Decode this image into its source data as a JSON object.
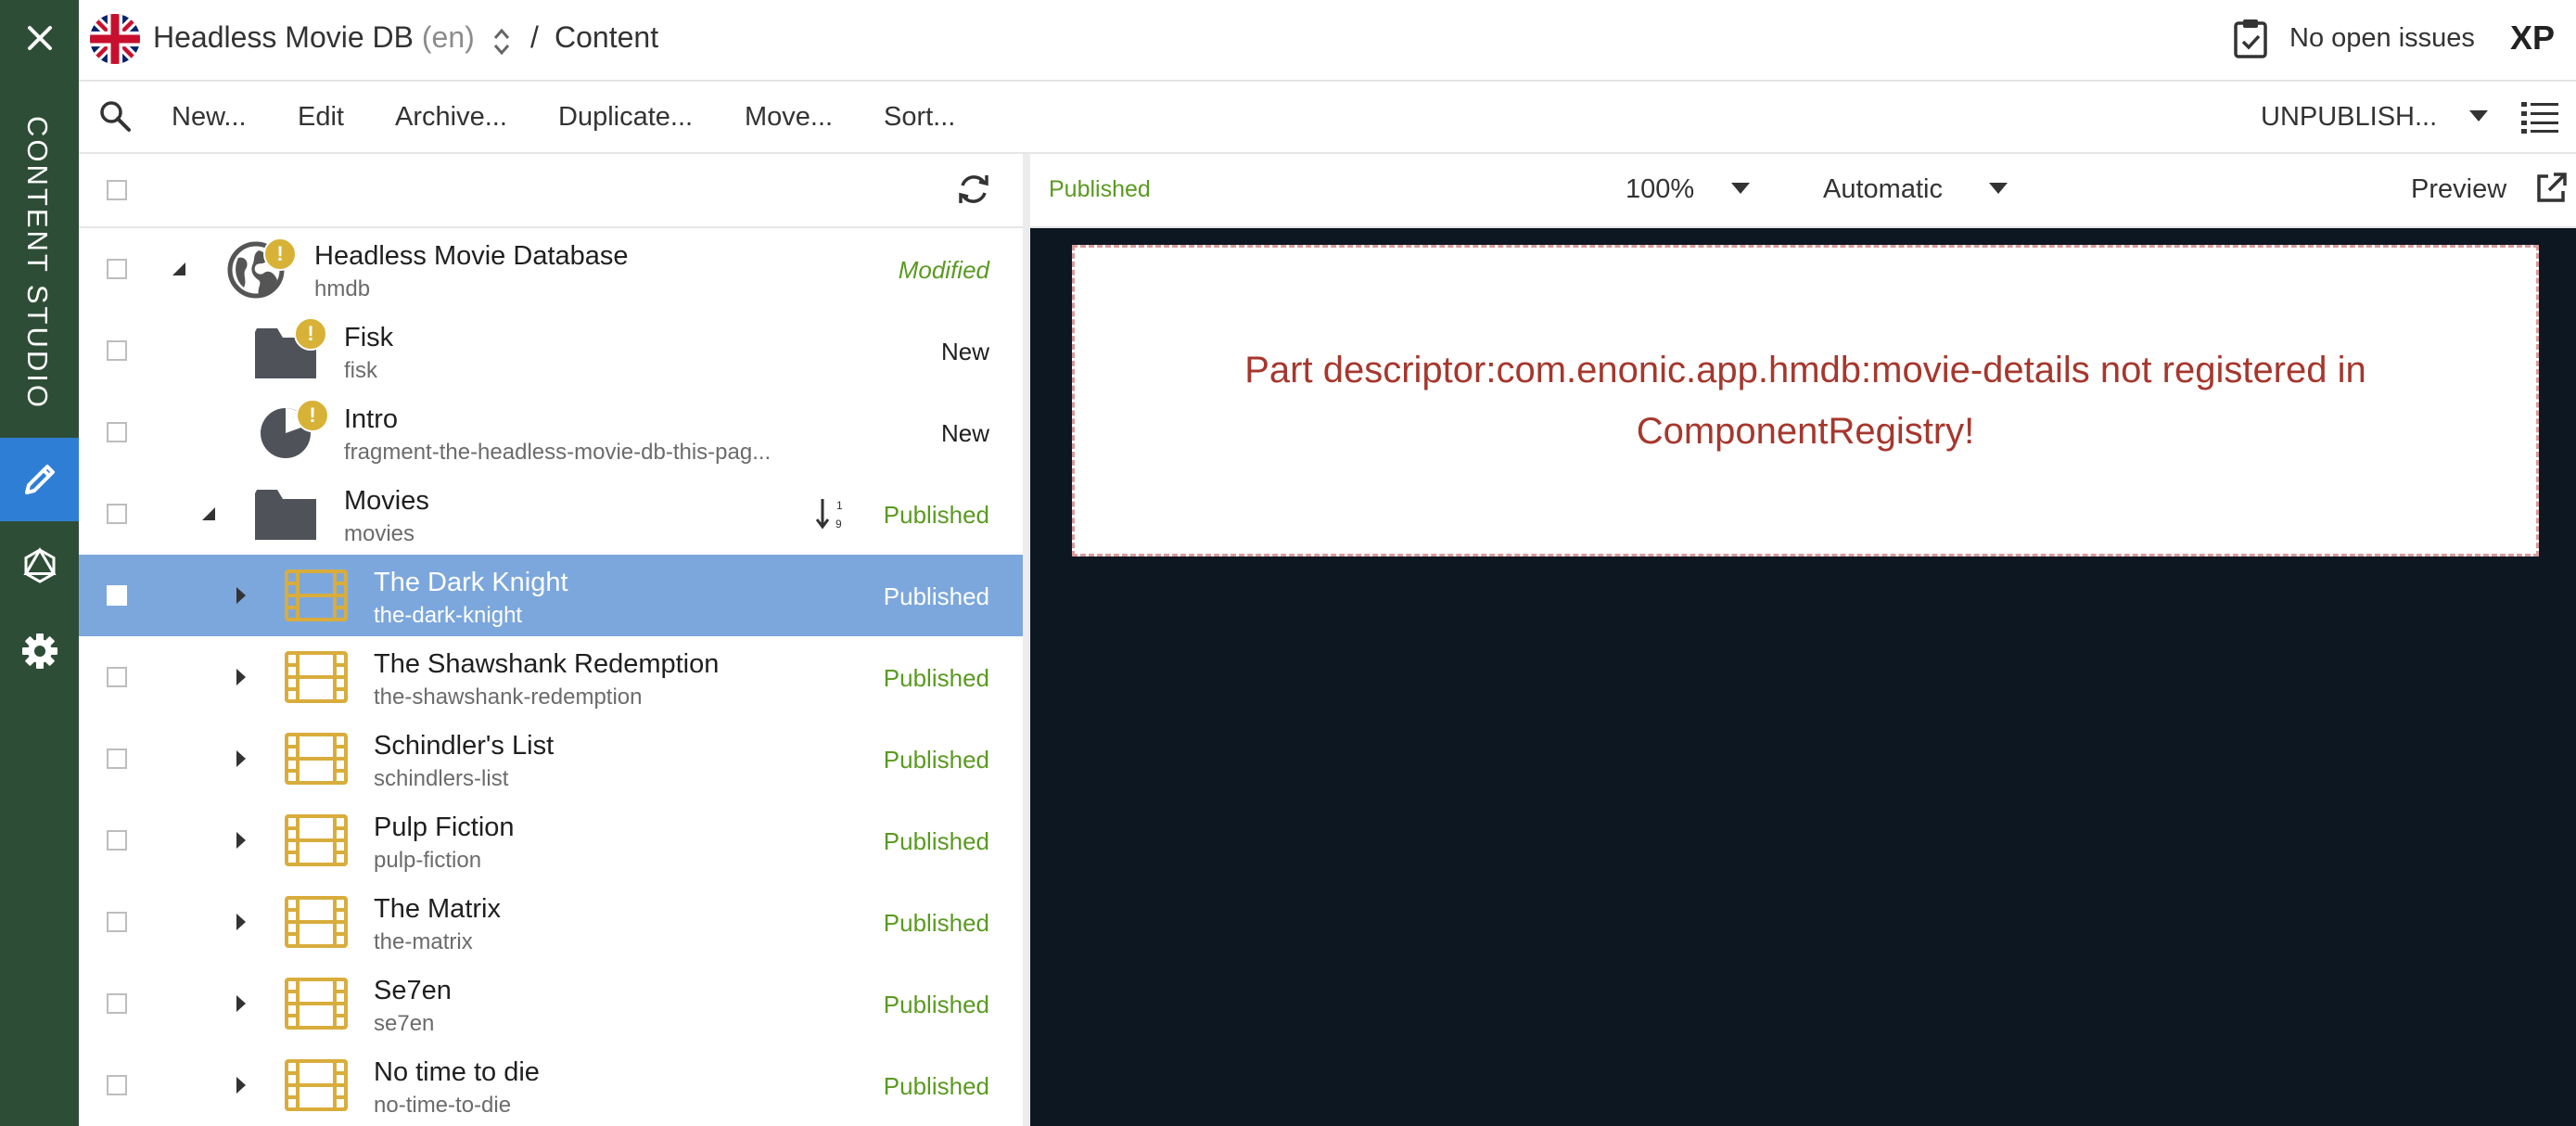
{
  "rail": {
    "title": "CONTENT STUDIO"
  },
  "header": {
    "project_name": "Headless Movie DB",
    "project_lang": "(en)",
    "separator": "/",
    "breadcrumb": "Content",
    "issues_label": "No open issues",
    "brand": "XP"
  },
  "toolbar": {
    "items": [
      "New...",
      "Edit",
      "Archive...",
      "Duplicate...",
      "Move...",
      "Sort..."
    ],
    "publish_action": "UNPUBLISH..."
  },
  "tree": {
    "rows": [
      {
        "name": "Headless Movie Database",
        "path": "hmdb",
        "status": "Modified",
        "icon": "site-globe-icon",
        "warning": true
      },
      {
        "name": "Fisk",
        "path": "fisk",
        "status": "New",
        "icon": "folder-icon",
        "warning": true
      },
      {
        "name": "Intro",
        "path": "fragment-the-headless-movie-db-this-pag...",
        "status": "New",
        "icon": "fragment-pie-icon",
        "warning": true
      },
      {
        "name": "Movies",
        "path": "movies",
        "status": "Published",
        "icon": "folder-icon",
        "warning": false
      },
      {
        "name": "The Dark Knight",
        "path": "the-dark-knight",
        "status": "Published",
        "icon": "film-icon",
        "selected": true
      },
      {
        "name": "The Shawshank Redemption",
        "path": "the-shawshank-redemption",
        "status": "Published",
        "icon": "film-icon"
      },
      {
        "name": "Schindler's List",
        "path": "schindlers-list",
        "status": "Published",
        "icon": "film-icon"
      },
      {
        "name": "Pulp Fiction",
        "path": "pulp-fiction",
        "status": "Published",
        "icon": "film-icon"
      },
      {
        "name": "The Matrix",
        "path": "the-matrix",
        "status": "Published",
        "icon": "film-icon"
      },
      {
        "name": "Se7en",
        "path": "se7en",
        "status": "Published",
        "icon": "film-icon"
      },
      {
        "name": "No time to die",
        "path": "no-time-to-die",
        "status": "Published",
        "icon": "film-icon"
      }
    ]
  },
  "preview": {
    "status": "Published",
    "zoom": "100%",
    "mode": "Automatic",
    "preview_label": "Preview",
    "error_message": "Part descriptor:com.enonic.app.hmdb:movie-details not registered in ComponentRegistry!"
  },
  "colors": {
    "rail_bg": "#2e4d36",
    "rail_active": "#2f7ed6",
    "selected_row": "#7ca7dc",
    "published": "#5a9a20",
    "error_text": "#a6372d",
    "preview_bg": "#0d1722",
    "film_icon": "#d8ad3c",
    "warning": "#d7b236"
  }
}
